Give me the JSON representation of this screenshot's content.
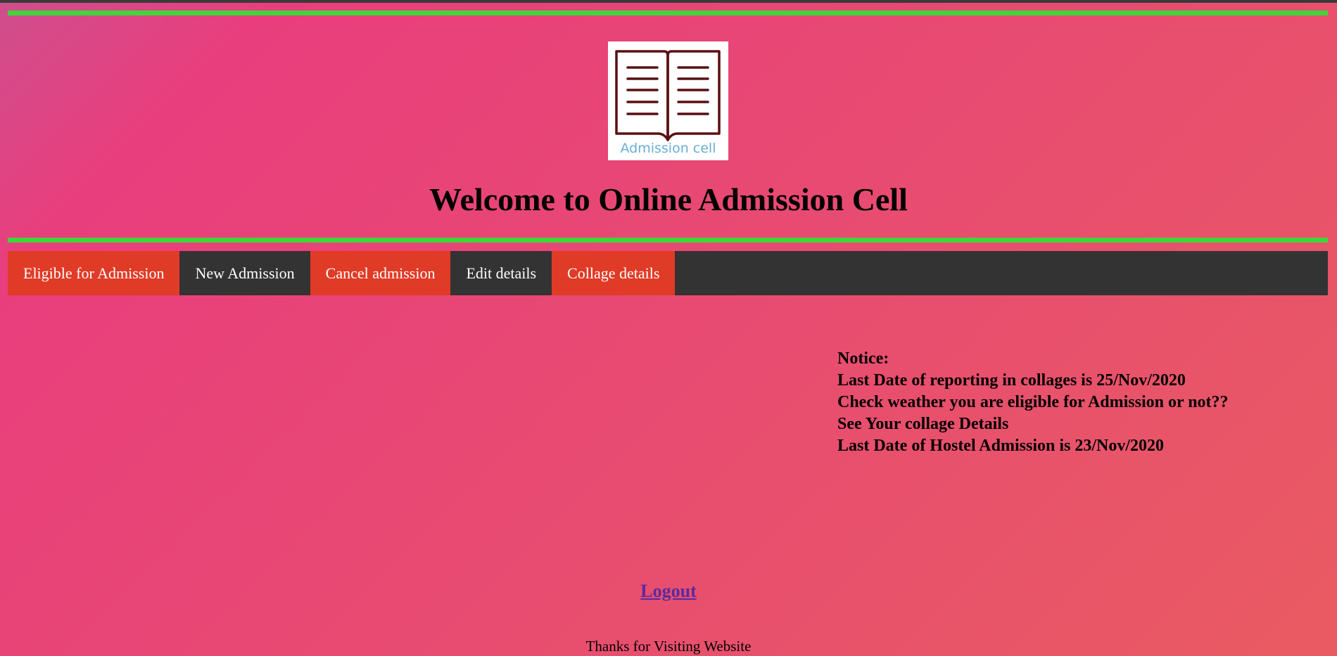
{
  "logo": {
    "icon": "open-book-icon",
    "caption": "Admission cell"
  },
  "header": {
    "title": "Welcome to Online Admission Cell"
  },
  "nav": {
    "items": [
      {
        "label": "Eligible for Admission",
        "style": "red"
      },
      {
        "label": "New Admission",
        "style": "dark"
      },
      {
        "label": "Cancel admission",
        "style": "red"
      },
      {
        "label": "Edit details",
        "style": "dark"
      },
      {
        "label": "Collage details",
        "style": "red"
      }
    ]
  },
  "notice": {
    "heading": "Notice:",
    "lines": [
      "Last Date of reporting in collages is 25/Nov/2020",
      "Check weather you are eligible for Admission or not??",
      "See Your collage Details",
      "Last Date of Hostel Admission is 23/Nov/2020"
    ]
  },
  "logout": {
    "label": "Logout"
  },
  "footer": {
    "text": "Thanks for Visiting Website"
  },
  "colors": {
    "accent_green": "#3fd63a",
    "nav_red": "#e03b26",
    "nav_dark": "#333333",
    "link_purple": "#5a2aa0"
  }
}
